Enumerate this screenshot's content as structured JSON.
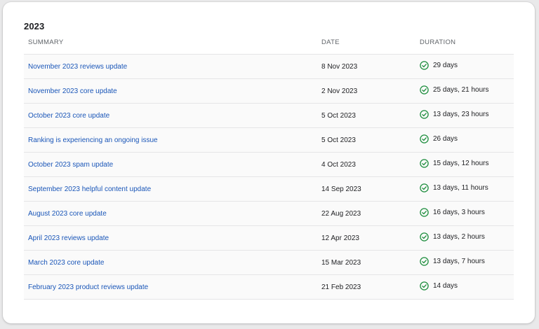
{
  "section": {
    "year": "2023"
  },
  "table": {
    "headers": {
      "summary": "SUMMARY",
      "date": "DATE",
      "duration": "DURATION"
    },
    "status_icon": "check-circle-icon",
    "status_color": "#1e8e3e",
    "link_color": "#1a56b8",
    "rows": [
      {
        "summary": "November 2023 reviews update",
        "date": "8 Nov 2023",
        "duration": "29 days"
      },
      {
        "summary": "November 2023 core update",
        "date": "2 Nov 2023",
        "duration": "25 days, 21 hours"
      },
      {
        "summary": "October 2023 core update",
        "date": "5 Oct 2023",
        "duration": "13 days, 23 hours"
      },
      {
        "summary": "Ranking is experiencing an ongoing issue",
        "date": "5 Oct 2023",
        "duration": "26 days"
      },
      {
        "summary": "October 2023 spam update",
        "date": "4 Oct 2023",
        "duration": "15 days, 12 hours"
      },
      {
        "summary": "September 2023 helpful content update",
        "date": "14 Sep 2023",
        "duration": "13 days, 11 hours"
      },
      {
        "summary": "August 2023 core update",
        "date": "22 Aug 2023",
        "duration": "16 days, 3 hours"
      },
      {
        "summary": "April 2023 reviews update",
        "date": "12 Apr 2023",
        "duration": "13 days, 2 hours"
      },
      {
        "summary": "March 2023 core update",
        "date": "15 Mar 2023",
        "duration": "13 days, 7 hours"
      },
      {
        "summary": "February 2023 product reviews update",
        "date": "21 Feb 2023",
        "duration": "14 days"
      }
    ]
  }
}
